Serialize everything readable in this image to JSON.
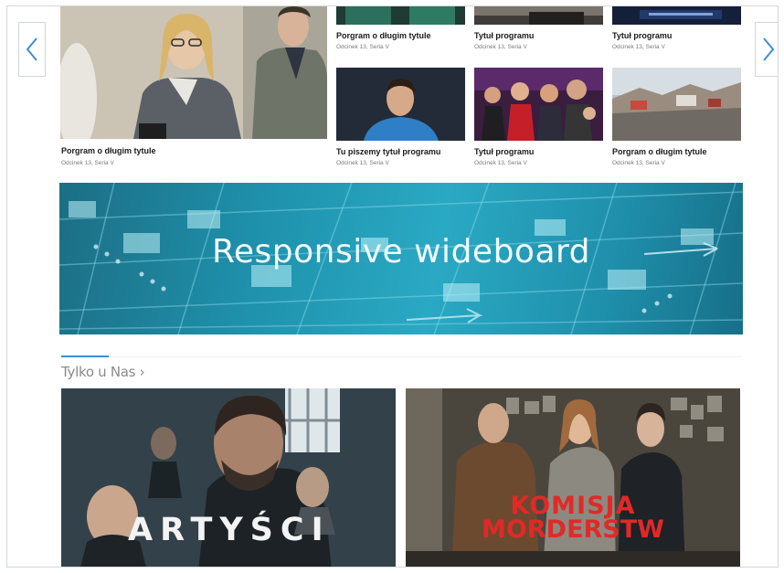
{
  "carousel": {
    "prev_icon": "chevron-left-icon",
    "next_icon": "chevron-right-icon",
    "big_tile": {
      "title": "Porgram o długim tytule",
      "subtitle": "Odcinek 13, Seria V"
    },
    "top_row": [
      {
        "title": "Porgram o długim tytule",
        "subtitle": "Odcinek 13, Seria V"
      },
      {
        "title": "Tytuł programu",
        "subtitle": "Odcinek 13, Seria V"
      },
      {
        "title": "Tytuł programu",
        "subtitle": "Odcinek 13, Seria V"
      }
    ],
    "bottom_row": [
      {
        "title": "Tu piszemy tytuł programu",
        "subtitle": "Odcinek 13, Seria V"
      },
      {
        "title": "Tytuł programu",
        "subtitle": "Odcinek 13, Seria V"
      },
      {
        "title": "Porgram o długim tytule",
        "subtitle": "Odcinek 13, Seria V"
      }
    ]
  },
  "wideboard": {
    "label": "Responsive wideboard"
  },
  "section": {
    "title": "Tylko u Nas ›"
  },
  "promos": [
    {
      "logo": "ARTYŚCI"
    },
    {
      "logo_line1": "KOMISJA",
      "logo_line2": "MORDERSTW"
    }
  ],
  "colors": {
    "accent": "#3e8ed0",
    "brand_red": "#e02a28",
    "wideboard": "#2aa9c4"
  }
}
